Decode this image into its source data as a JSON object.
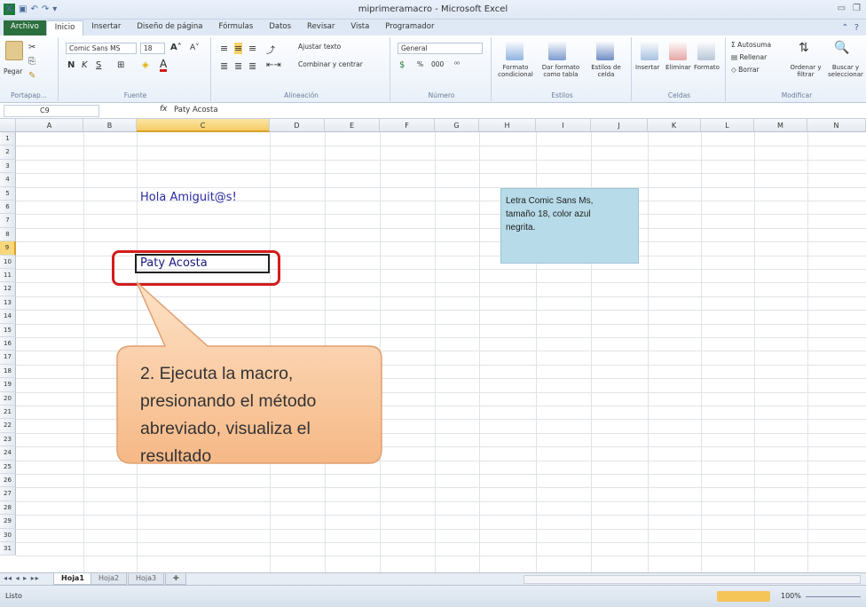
{
  "window": {
    "title": "miprimeramacro - Microsoft Excel"
  },
  "tabs": [
    "Archivo",
    "Inicio",
    "Insertar",
    "Diseño de página",
    "Fórmulas",
    "Datos",
    "Revisar",
    "Vista",
    "Programador"
  ],
  "ribbon": {
    "clipboard": {
      "paste": "Pegar",
      "label": "Portapap..."
    },
    "font": {
      "name": "Comic Sans MS",
      "size": "18",
      "bold": "N",
      "italic": "K",
      "underline": "S",
      "label": "Fuente"
    },
    "alignment": {
      "wrap": "Ajustar texto",
      "merge": "Combinar y centrar",
      "label": "Alineación"
    },
    "number": {
      "format": "General",
      "percent": "%",
      "thousands": "000",
      "label": "Número"
    },
    "styles": {
      "conditional": "Formato condicional",
      "table": "Dar formato como tabla",
      "cell": "Estilos de celda",
      "label": "Estilos"
    },
    "cells": {
      "insert": "Insertar",
      "delete": "Eliminar",
      "format": "Formato",
      "label": "Celdas"
    },
    "editing": {
      "autosum": "Autosuma",
      "fill": "Rellenar",
      "clear": "Borrar",
      "sort": "Ordenar y filtrar",
      "find": "Buscar y seleccionar",
      "label": "Modificar"
    }
  },
  "formula_bar": {
    "cell_ref": "C9",
    "fx": "fx",
    "value": "Paty Acosta"
  },
  "columns": [
    "A",
    "B",
    "C",
    "D",
    "E",
    "F",
    "G",
    "H",
    "I",
    "J",
    "K",
    "L",
    "M",
    "N"
  ],
  "rows": [
    "1",
    "2",
    "3",
    "4",
    "5",
    "6",
    "7",
    "8",
    "9",
    "10",
    "11",
    "12",
    "13",
    "14",
    "15",
    "16",
    "17",
    "18",
    "19",
    "20",
    "21",
    "22",
    "23",
    "24",
    "25",
    "26",
    "27",
    "28",
    "29",
    "30",
    "31"
  ],
  "cells": {
    "greeting": "Hola Amiguit@s!",
    "name": "Paty Acosta"
  },
  "note": "Letra Comic Sans Ms,\ntamaño 18, color azul\nnegrita.",
  "callout": "2. Ejecuta la macro, presionando el método abreviado, visualiza el resultado",
  "sheets": [
    "Hoja1",
    "Hoja2",
    "Hoja3"
  ],
  "status": {
    "mode": "Listo",
    "zoom": "100%"
  },
  "colors": {
    "file_tab": "#2b6f3e",
    "red_highlight": "#d21c1c",
    "note_bg": "#b7dbe8",
    "callout_fill": "#f9c9a0",
    "greeting_text": "#2a2aa0"
  }
}
